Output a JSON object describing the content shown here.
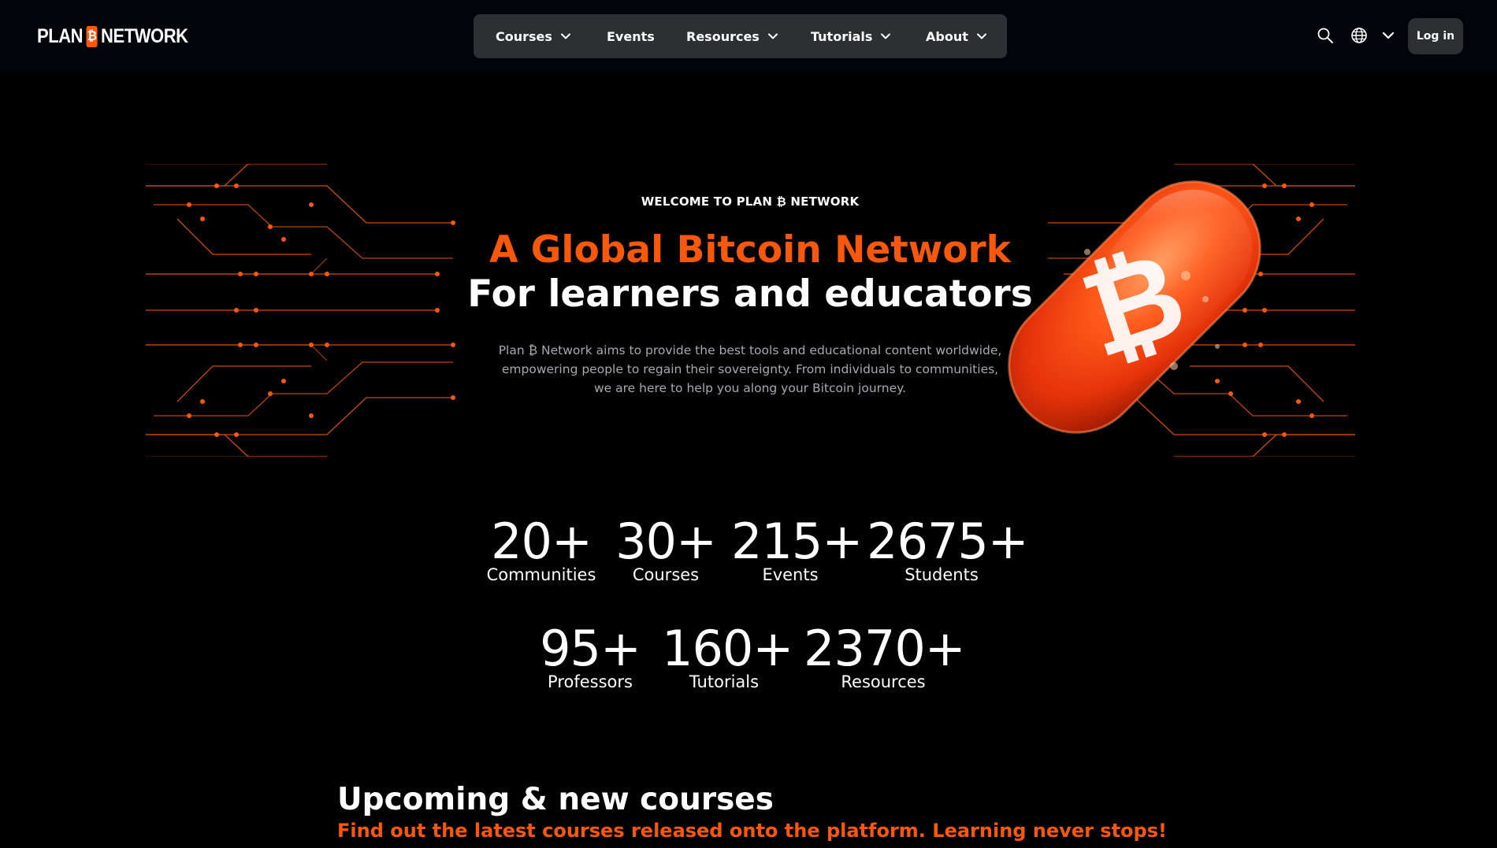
{
  "header": {
    "logo_left": "PLAN",
    "logo_mark": "₿",
    "logo_right": "NETWORK",
    "nav": [
      {
        "label": "Courses",
        "has_dropdown": true
      },
      {
        "label": "Events",
        "has_dropdown": false
      },
      {
        "label": "Resources",
        "has_dropdown": true
      },
      {
        "label": "Tutorials",
        "has_dropdown": true
      },
      {
        "label": "About",
        "has_dropdown": true
      }
    ],
    "icons": [
      "search-icon",
      "globe-icon",
      "chevron-down-icon"
    ],
    "login_label": "Log in"
  },
  "hero": {
    "eyebrow": "WELCOME TO PLAN ₿ NETWORK",
    "title_line1": "A Global Bitcoin Network",
    "title_line2": "For learners and educators",
    "description": "Plan ₿ Network aims to provide the best tools and educational content worldwide, empowering people to regain their sovereignty. From individuals to communities, we are here to help you along your Bitcoin journey.",
    "pill_symbol": "₿"
  },
  "stats": [
    {
      "value": "20+",
      "label": "Communities"
    },
    {
      "value": "30+",
      "label": "Courses"
    },
    {
      "value": "215+",
      "label": "Events"
    },
    {
      "value": "2675+",
      "label": "Students"
    },
    {
      "value": "95+",
      "label": "Professors"
    },
    {
      "value": "160+",
      "label": "Tutorials"
    },
    {
      "value": "2370+",
      "label": "Resources"
    }
  ],
  "upcoming": {
    "title": "Upcoming & new courses",
    "subtitle": "Find out the latest courses released onto the platform. Learning never stops!"
  },
  "colors": {
    "accent": "#f7580c",
    "background": "#000000",
    "nav_bg": "#2e2f33",
    "muted_text": "#a7a9b0"
  }
}
